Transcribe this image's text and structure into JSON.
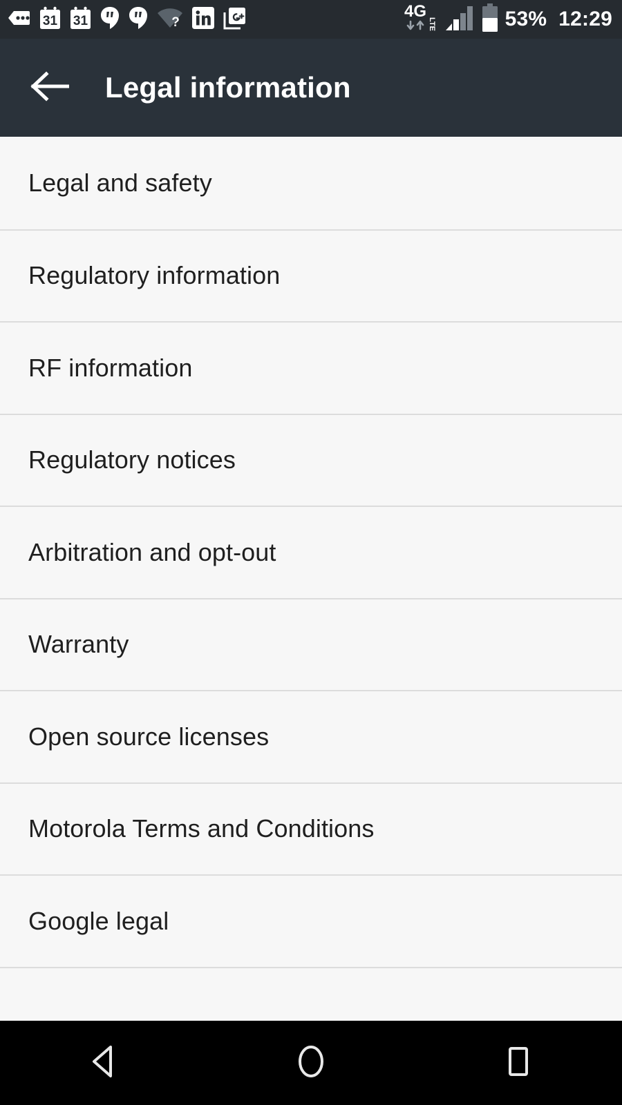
{
  "status_bar": {
    "background": "#262b30",
    "notification_icons": [
      {
        "name": "more-notifications-icon",
        "label": "More notifications"
      },
      {
        "name": "calendar-icon",
        "label": "31"
      },
      {
        "name": "calendar-icon",
        "label": "31"
      },
      {
        "name": "hangouts-icon",
        "label": "Hangouts"
      },
      {
        "name": "hangouts-icon",
        "label": "Hangouts"
      },
      {
        "name": "wifi-no-internet-icon",
        "label": "Wi-Fi no internet"
      },
      {
        "name": "linkedin-icon",
        "label": "in"
      },
      {
        "name": "google-plus-icon",
        "label": "G+"
      }
    ],
    "network_type": "4G",
    "network_suffix": "LTE",
    "signal_bars_filled": 2,
    "signal_bars_total": 4,
    "battery_percent_text": "53%",
    "battery_level": 53,
    "clock": "12:29"
  },
  "toolbar": {
    "background": "#2a323a",
    "back_icon": "arrow-left-icon",
    "title": "Legal information"
  },
  "list": {
    "background": "#f7f7f7",
    "divider_color": "#dcdcdc",
    "text_color": "#1f1f1f",
    "items": [
      {
        "label": "Legal and safety"
      },
      {
        "label": "Regulatory information"
      },
      {
        "label": "RF information"
      },
      {
        "label": "Regulatory notices"
      },
      {
        "label": "Arbitration and opt-out"
      },
      {
        "label": "Warranty"
      },
      {
        "label": "Open source licenses"
      },
      {
        "label": "Motorola Terms and Conditions"
      },
      {
        "label": "Google legal"
      },
      {
        "label": ""
      }
    ]
  },
  "nav_bar": {
    "background": "#000000",
    "buttons": [
      {
        "name": "nav-back-button",
        "icon": "triangle-left-icon",
        "label": "Back"
      },
      {
        "name": "nav-home-button",
        "icon": "circle-icon",
        "label": "Home"
      },
      {
        "name": "nav-recents-button",
        "icon": "square-icon",
        "label": "Recents"
      }
    ]
  }
}
